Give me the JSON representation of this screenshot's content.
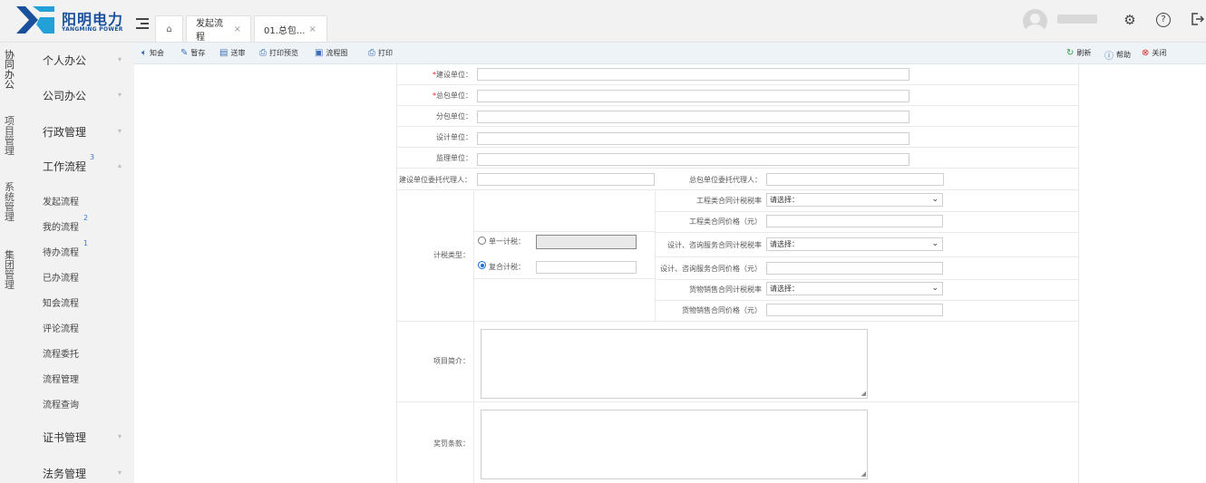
{
  "brand": {
    "name_cn": "阳明电力",
    "name_en": "YANGMING POWER",
    "accent": "#1a4f9c"
  },
  "tabs": [
    {
      "label": "发起流程",
      "close": "×"
    },
    {
      "label": "01.总包...",
      "close": "×"
    }
  ],
  "modules": [
    "协同办公",
    "项目管理",
    "系统管理",
    "集团管理"
  ],
  "sidebar": {
    "main_items": [
      "个人办公",
      "公司办公",
      "行政管理",
      "工作流程",
      "证书管理",
      "法务管理"
    ],
    "workflow_badge": "3",
    "sub_items": [
      {
        "label": "发起流程",
        "badge": ""
      },
      {
        "label": "我的流程",
        "badge": "2"
      },
      {
        "label": "待办流程",
        "badge": "1"
      },
      {
        "label": "已办流程",
        "badge": ""
      },
      {
        "label": "知会流程",
        "badge": ""
      },
      {
        "label": "评论流程",
        "badge": ""
      },
      {
        "label": "流程委托",
        "badge": ""
      },
      {
        "label": "流程管理",
        "badge": ""
      },
      {
        "label": "流程查询",
        "badge": ""
      }
    ]
  },
  "toolbar": {
    "notify": "知会",
    "save_draft": "暂存",
    "submit": "送审",
    "print_preview": "打印预览",
    "flowchart": "流程图",
    "print": "打印",
    "refresh": "刷新",
    "help": "帮助",
    "close": "关闭"
  },
  "form": {
    "construction_unit": "建设单位：",
    "general_contractor": "总包单位：",
    "subcontractor": "分包单位：",
    "design_unit": "设计单位：",
    "supervision_unit": "监理单位：",
    "construction_agent": "建设单位委托代理人：",
    "contractor_agent": "总包单位委托代理人：",
    "tax_type": "计税类型：",
    "single_tax": "单一计税：",
    "composite_tax": "复合计税：",
    "engineering_tax_rate": "工程类合同计税税率",
    "engineering_price": "工程类合同价格（元）",
    "design_tax_rate": "设计、咨询服务合同计税税率",
    "design_price": "设计、咨询服务合同价格（元）",
    "goods_tax_rate": "货物销售合同计税税率",
    "goods_price": "货物销售合同价格（元）",
    "select_placeholder": "请选择：",
    "project_intro": "项目简介：",
    "reward_penalty": "奖罚条款："
  }
}
